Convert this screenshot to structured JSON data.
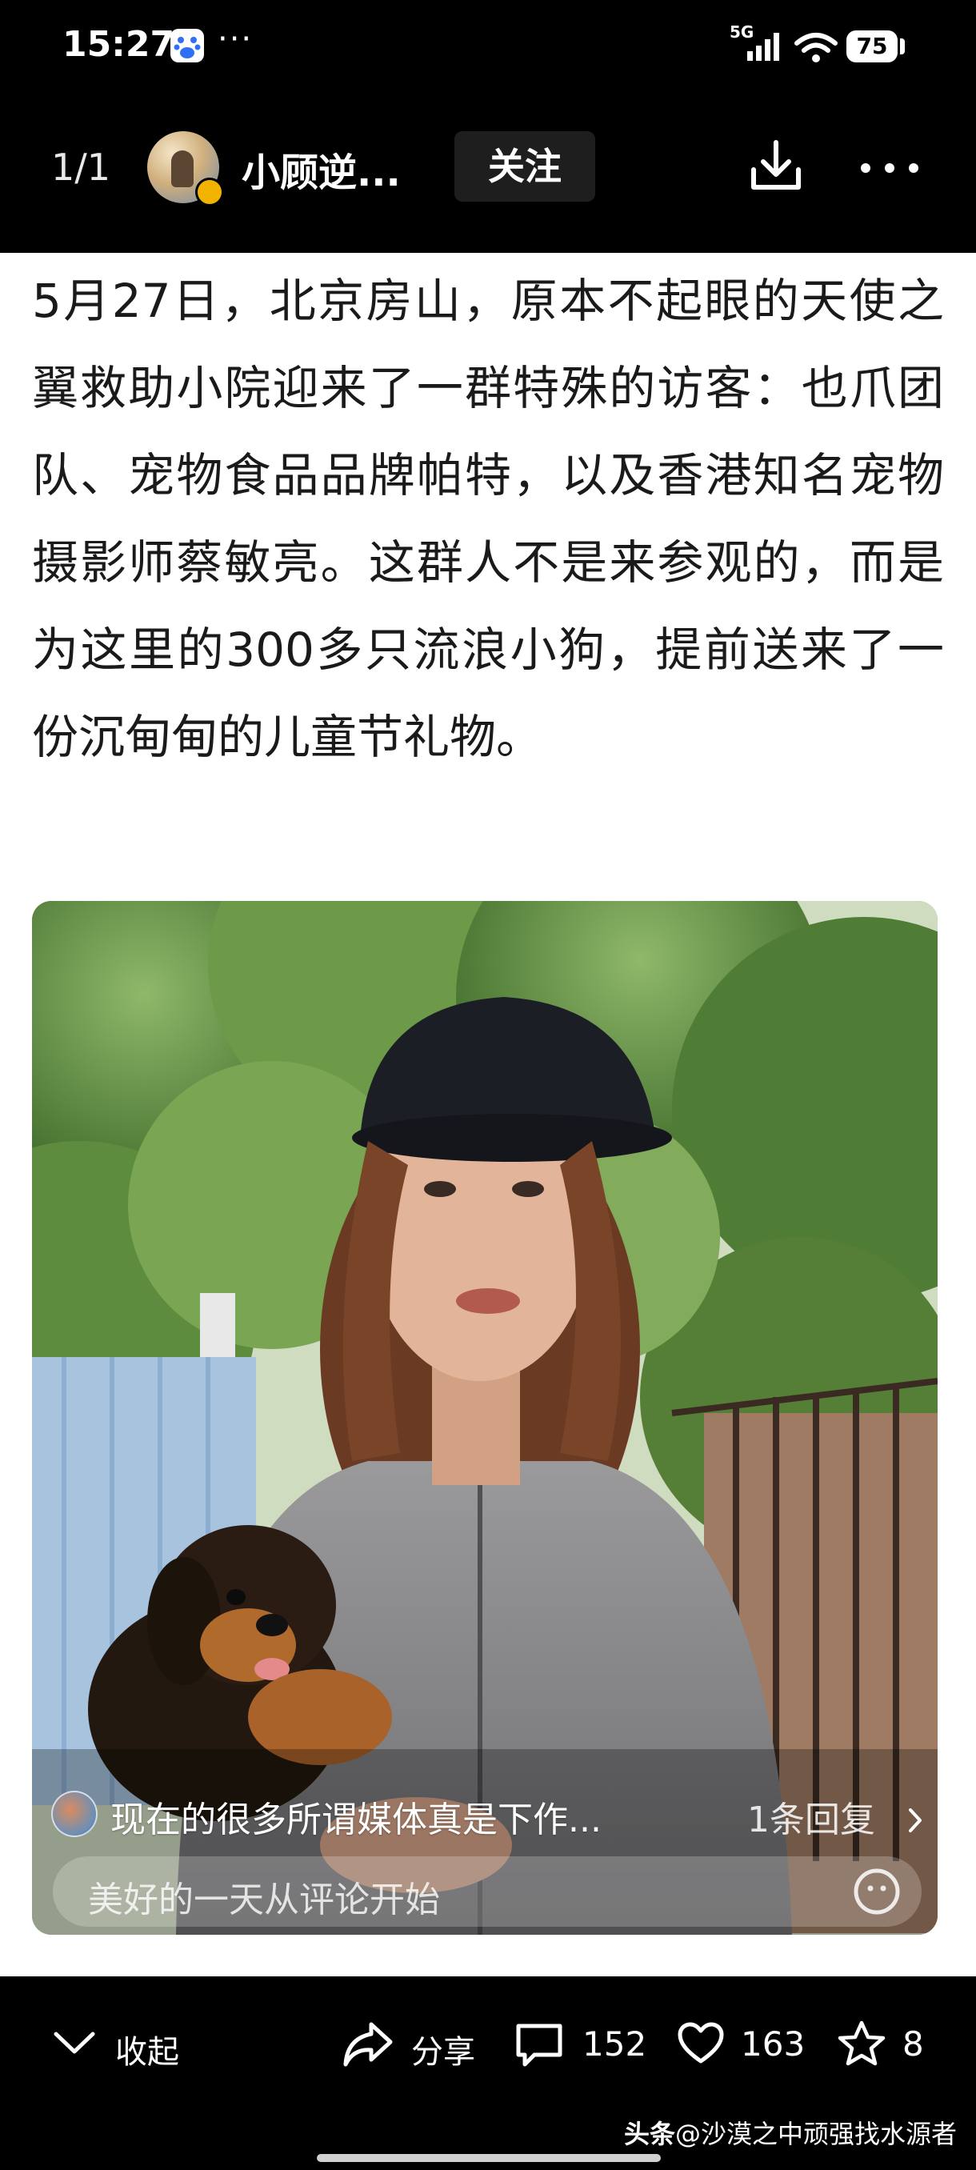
{
  "status_bar": {
    "time": "15:27",
    "more": "···",
    "network": "5G",
    "battery": "75"
  },
  "header": {
    "page_counter": "1/1",
    "author_name": "小顾逆...",
    "follow_label": "关注",
    "icons": [
      "download-icon",
      "more-icon"
    ]
  },
  "article": {
    "text": "5月27日，北京房山，原本不起眼的天使之翼救助小院迎来了一群特殊的访客：也爪团队、宠物食品品牌帕特，以及香港知名宠物摄影师蔡敏亮。这群人不是来参观的，而是为这里的300多只流浪小狗，提前送来了一份沉甸甸的儿童节礼物。"
  },
  "photo_overlay": {
    "comment_text": "现在的很多所谓媒体真是下作...",
    "reply_count": "1条回复",
    "comment_placeholder": "美好的一天从评论开始"
  },
  "action_bar": {
    "collapse_label": "收起",
    "share_label": "分享",
    "comment_count": "152",
    "like_count": "163",
    "favorite_count": "8"
  },
  "watermark": {
    "brand": "头条",
    "handle": "@沙漠之中顽强找水源者"
  },
  "colors": {
    "bar_background": "#000000",
    "text": "#1a1a1a",
    "badge": "#f2b300"
  }
}
